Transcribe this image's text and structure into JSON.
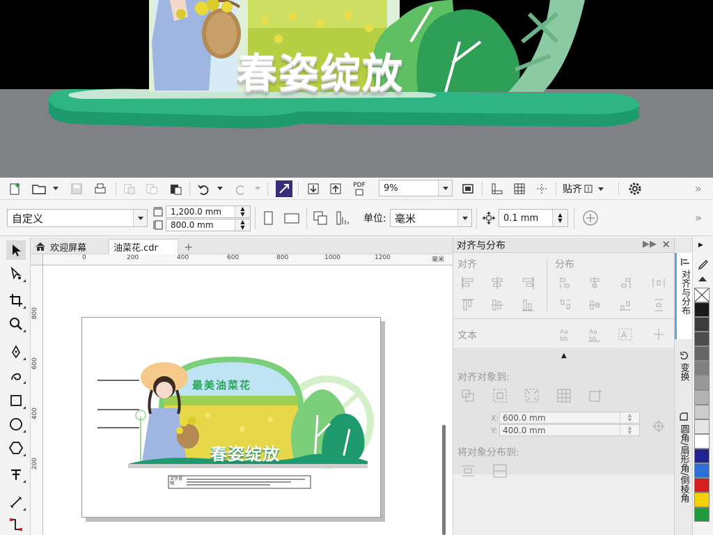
{
  "render_preview": {
    "banner_title": "春姿绽放",
    "colors": {
      "background": "#000000",
      "floor": "#7f8184",
      "platform_green": "#1f9a6e",
      "platform_light": "#c8e7d2"
    }
  },
  "standard_toolbar": {
    "zoom_value": "9%",
    "pdf_label": "PDF",
    "snap_label": "贴齐",
    "more": "»"
  },
  "property_bar": {
    "page_preset": "自定义",
    "width": "1,200.0 mm",
    "height": "800.0 mm",
    "units_label": "单位:",
    "units_value": "毫米",
    "nudge": "0.1 mm",
    "more": "»"
  },
  "document_tabs": [
    {
      "label": "欢迎屏幕",
      "icon": "home-icon"
    },
    {
      "label": "油菜花.cdr"
    }
  ],
  "rulers": {
    "horizontal": [
      "0",
      "200",
      "400",
      "600",
      "800",
      "1000",
      "1200"
    ],
    "horizontal_unit": "毫米",
    "vertical": [
      "800",
      "600",
      "400",
      "200"
    ]
  },
  "design": {
    "title": "春姿绽放",
    "subtitle": "最美油菜花",
    "caption_box": "文字说明",
    "colors": {
      "green_dark": "#1f9a6e",
      "green_light": "#7ccf7a",
      "arch_light": "#d4f0c8",
      "field_yellow": "#e7d84a"
    }
  },
  "docker": {
    "title": "对齐与分布",
    "align_label": "对齐",
    "distribute_label": "分布",
    "text_label": "文本",
    "align_to_label": "对齐对象到:",
    "x_label": "X:",
    "x_value": "600.0 mm",
    "y_label": "Y:",
    "y_value": "400.0 mm",
    "distribute_to_label": "将对象分布到:"
  },
  "vertical_tabs": [
    {
      "label": "对齐与分布",
      "active": true
    },
    {
      "label": "变换"
    },
    {
      "label": "圆角/扇形角/倒棱角"
    }
  ],
  "palette": [
    "#ffffff",
    "#1a1a1a",
    "#3c3c3c",
    "#4d4d4d",
    "#666666",
    "#808080",
    "#999999",
    "#b3b3b3",
    "#cccccc",
    "#e6e6e6",
    "#ffffff",
    "#23238f",
    "#2e6fd6",
    "#d62020",
    "#f2d300",
    "#1f9a3e"
  ]
}
